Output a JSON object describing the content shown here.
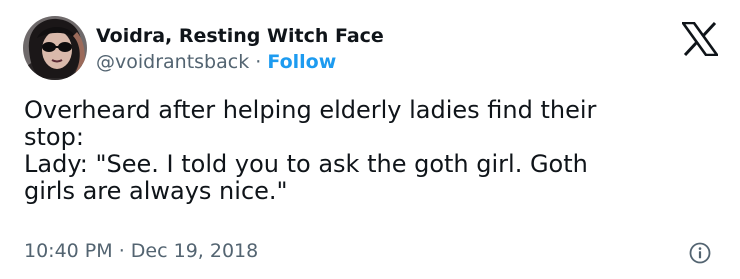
{
  "author": {
    "display_name": "Voidra, Resting Witch Face",
    "handle": "@voidrantsback",
    "separator": "·",
    "follow_label": "Follow"
  },
  "tweet": {
    "lines": [
      "Overheard after helping elderly ladies find their",
      "stop:",
      "Lady: \"See. I told you to ask the goth girl. Goth",
      "girls are always nice.\""
    ]
  },
  "meta": {
    "time": "10:40 PM",
    "separator": "·",
    "date": "Dec 19, 2018"
  },
  "icons": {
    "brand": "x-logo-icon",
    "info": "info-icon",
    "avatar": "avatar"
  },
  "colors": {
    "text_primary": "#0f1419",
    "text_secondary": "#536471",
    "link": "#1d9bf0",
    "background": "#ffffff"
  }
}
